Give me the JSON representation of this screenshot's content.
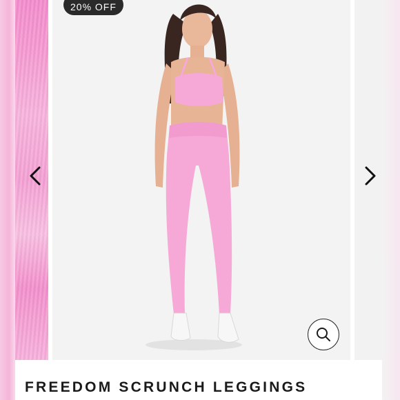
{
  "badge": {
    "text": "20% OFF"
  },
  "product": {
    "title": "FREEDOM SCRUNCH LEGGINGS"
  },
  "gallery": {
    "prev_icon": "chevron-left-icon",
    "next_icon": "chevron-right-icon",
    "zoom_icon": "search-icon",
    "image_subject": "model wearing pink sports bra and pink leggings with white sneakers"
  },
  "colors": {
    "product_pink": "#f6a9d6",
    "badge_bg": "#2a2a2a",
    "stage_bg": "#f3f3f3"
  }
}
